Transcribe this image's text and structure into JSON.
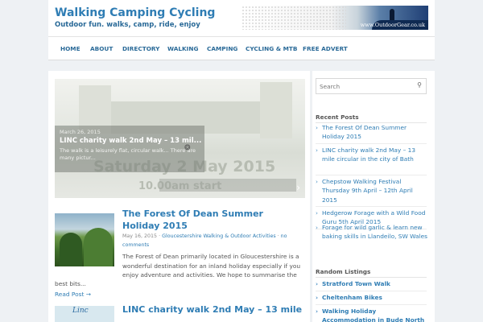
{
  "site": {
    "title": "Walking Camping Cycling",
    "tagline": "Outdoor fun. walks, camp, ride, enjoy",
    "banner_text": "www.OutdoorGear.co.uk"
  },
  "nav": {
    "items": [
      "HOME",
      "ABOUT",
      "DIRECTORY",
      "WALKING",
      "CAMPING",
      "CYCLING & MTB",
      "FREE ADVERT"
    ]
  },
  "slider": {
    "date": "March 26, 2015",
    "title": "LINC charity walk 2nd May – 13 mil...",
    "text": "The walk is a leisurely flat, circular walk... There are many pictur...",
    "big_text_1": "Saturday 2 May 2015",
    "big_text_2": "10.00am start"
  },
  "post1": {
    "title": "The Forest Of Dean Summer Holiday 2015",
    "date": "May 16, 2015",
    "category": "Gloucestershire Walking & Outdoor Activities",
    "comments": "no comments",
    "excerpt_1": "The Forest of Dean primarily located in Gloucestershire is a wonderful destination for an inland holiday especially if you enjoy adventure and activities. We hope to summarise the",
    "excerpt_2": "best bits...",
    "read_more": "Read Post →"
  },
  "post2": {
    "title": "LINC charity walk 2nd May – 13 mile",
    "thumb_text": "Linc"
  },
  "sidebar": {
    "search_placeholder": "Search",
    "recent_title": "Recent Posts",
    "recent": [
      "The Forest Of Dean Summer Holiday 2015",
      "LINC charity walk 2nd May – 13 mile circular in the city of Bath",
      "Chepstow Walking Festival Thursday 9th April – 12th April 2015",
      "Hedgerow Forage with a Wild Food Guru 5th April 2015",
      "Forage for wild garlic & learn new baking skills in Llandeilo, SW Wales"
    ],
    "listings_title": "Random Listings",
    "listings": [
      "Stratford Town Walk",
      "Cheltenham Bikes",
      "Walking Holiday Accommodation in Bude North"
    ]
  },
  "colors": {
    "accent": "#2f7db4",
    "background": "#eef1f4"
  },
  "icons": {
    "search": "magnifier-icon",
    "bullet": "chevron-right-icon",
    "spinner": "loading-icon"
  }
}
